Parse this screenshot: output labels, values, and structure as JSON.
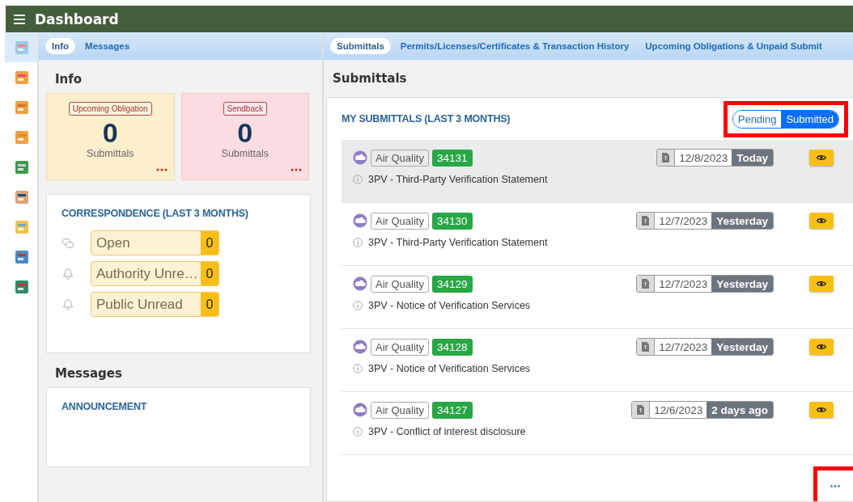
{
  "header": {
    "title": "Dashboard"
  },
  "sidebar": {
    "items": [
      {
        "selected": true
      },
      {
        "selected": false
      },
      {
        "selected": false
      },
      {
        "selected": false
      },
      {
        "selected": false
      },
      {
        "selected": false
      },
      {
        "selected": false
      },
      {
        "selected": false
      },
      {
        "selected": false
      }
    ]
  },
  "left": {
    "tabs": [
      {
        "label": "Info",
        "selected": true
      },
      {
        "label": "Messages",
        "selected": false
      }
    ],
    "info_heading": "Info",
    "info_cards": [
      {
        "kind": "warning",
        "badge": "Upcoming Obligation",
        "count": "0",
        "caption": "Submittals"
      },
      {
        "kind": "danger",
        "badge": "Sendback",
        "count": "0",
        "caption": "Submittals"
      }
    ],
    "correspondence": {
      "title": "CORRESPONDENCE (LAST 3 MONTHS)",
      "items": [
        {
          "kind": "chat",
          "label": "Open",
          "count": "0"
        },
        {
          "kind": "bell",
          "label": "Authority Unre…",
          "count": "0"
        },
        {
          "kind": "bell",
          "label": "Public Unread",
          "count": "0"
        }
      ]
    },
    "messages_heading": "Messages",
    "announcement": {
      "title": "ANNOUNCEMENT"
    }
  },
  "right": {
    "tabs": [
      {
        "label": "Submittals",
        "selected": true
      },
      {
        "label": "Permits/Licenses/Certificates & Transaction History",
        "selected": false
      },
      {
        "label": "Upcoming Obligations & Unpaid Submit",
        "selected": false
      }
    ],
    "heading": "Submittals",
    "card_title": "MY SUBMITTALS (LAST 3 MONTHS)",
    "toggle": {
      "highlighted": true,
      "options": [
        {
          "label": "Pending",
          "selected": false
        },
        {
          "label": "Submitted",
          "selected": true
        }
      ]
    },
    "rows": [
      {
        "selected": true,
        "category": "Air Quality",
        "number": "34131",
        "date": "12/8/2023",
        "relative": "Today",
        "title": "3PV - Third-Party Verification Statement"
      },
      {
        "selected": false,
        "category": "Air Quality",
        "number": "34130",
        "date": "12/7/2023",
        "relative": "Yesterday",
        "title": "3PV - Third-Party Verification Statement"
      },
      {
        "selected": false,
        "category": "Air Quality",
        "number": "34129",
        "date": "12/7/2023",
        "relative": "Yesterday",
        "title": "3PV - Notice of Verification Services"
      },
      {
        "selected": false,
        "category": "Air Quality",
        "number": "34128",
        "date": "12/7/2023",
        "relative": "Yesterday",
        "title": "3PV - Notice of Verification Services"
      },
      {
        "selected": false,
        "category": "Air Quality",
        "number": "34127",
        "date": "12/6/2023",
        "relative": "2 days ago",
        "title": "3PV - Conflict of interest disclosure"
      }
    ],
    "more_button": {
      "highlighted": true
    }
  }
}
